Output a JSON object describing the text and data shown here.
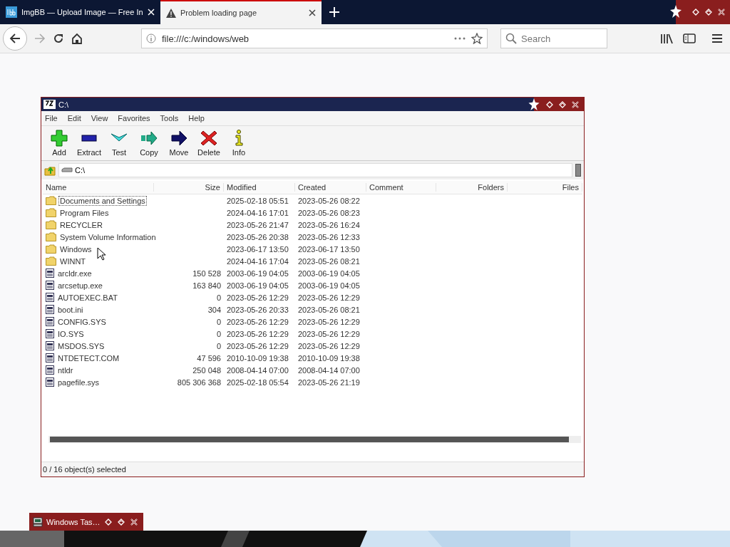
{
  "browser": {
    "tabs": [
      {
        "label": "ImgBB — Upload Image — Free In",
        "selected": false
      },
      {
        "label": "Problem loading page",
        "selected": true
      }
    ],
    "url": "file:///c:/windows/web",
    "search": {
      "placeholder": "Search"
    }
  },
  "window": {
    "title": "C:\\",
    "menu": [
      "File",
      "Edit",
      "View",
      "Favorites",
      "Tools",
      "Help"
    ],
    "toolbar": [
      {
        "label": "Add",
        "kind": "add"
      },
      {
        "label": "Extract",
        "kind": "extract"
      },
      {
        "label": "Test",
        "kind": "test"
      },
      {
        "label": "Copy",
        "kind": "copy"
      },
      {
        "label": "Move",
        "kind": "move"
      },
      {
        "label": "Delete",
        "kind": "delete"
      },
      {
        "label": "Info",
        "kind": "info"
      }
    ],
    "path": "C:\\",
    "columns": [
      "Name",
      "Size",
      "Modified",
      "Created",
      "Comment",
      "Folders",
      "Files"
    ],
    "rows": [
      {
        "kind": "folder",
        "name": "Documents and Settings",
        "size": "",
        "modified": "2025-02-18 05:51",
        "created": "2023-05-26 08:22",
        "focused": true
      },
      {
        "kind": "folder",
        "name": "Program Files",
        "size": "",
        "modified": "2024-04-16 17:01",
        "created": "2023-05-26 08:23",
        "focused": false
      },
      {
        "kind": "folder",
        "name": "RECYCLER",
        "size": "",
        "modified": "2023-05-26 21:47",
        "created": "2023-05-26 16:24",
        "focused": false
      },
      {
        "kind": "folder",
        "name": "System Volume Information",
        "size": "",
        "modified": "2023-05-26 20:38",
        "created": "2023-05-26 12:33",
        "focused": false
      },
      {
        "kind": "folder",
        "name": "Windows",
        "size": "",
        "modified": "2023-06-17 13:50",
        "created": "2023-06-17 13:50",
        "focused": false
      },
      {
        "kind": "folder",
        "name": "WINNT",
        "size": "",
        "modified": "2024-04-16 17:04",
        "created": "2023-05-26 08:21",
        "focused": false
      },
      {
        "kind": "file",
        "name": "arcldr.exe",
        "size": "150 528",
        "modified": "2003-06-19 04:05",
        "created": "2003-06-19 04:05",
        "focused": false
      },
      {
        "kind": "file",
        "name": "arcsetup.exe",
        "size": "163 840",
        "modified": "2003-06-19 04:05",
        "created": "2003-06-19 04:05",
        "focused": false
      },
      {
        "kind": "file",
        "name": "AUTOEXEC.BAT",
        "size": "0",
        "modified": "2023-05-26 12:29",
        "created": "2023-05-26 12:29",
        "focused": false
      },
      {
        "kind": "file",
        "name": "boot.ini",
        "size": "304",
        "modified": "2023-05-26 20:33",
        "created": "2023-05-26 08:21",
        "focused": false
      },
      {
        "kind": "file",
        "name": "CONFIG.SYS",
        "size": "0",
        "modified": "2023-05-26 12:29",
        "created": "2023-05-26 12:29",
        "focused": false
      },
      {
        "kind": "file",
        "name": "IO.SYS",
        "size": "0",
        "modified": "2023-05-26 12:29",
        "created": "2023-05-26 12:29",
        "focused": false
      },
      {
        "kind": "file",
        "name": "MSDOS.SYS",
        "size": "0",
        "modified": "2023-05-26 12:29",
        "created": "2023-05-26 12:29",
        "focused": false
      },
      {
        "kind": "file",
        "name": "NTDETECT.COM",
        "size": "47 596",
        "modified": "2010-10-09 19:38",
        "created": "2010-10-09 19:38",
        "focused": false
      },
      {
        "kind": "file",
        "name": "ntldr",
        "size": "250 048",
        "modified": "2008-04-14 07:00",
        "created": "2008-04-14 07:00",
        "focused": false
      },
      {
        "kind": "file",
        "name": "pagefile.sys",
        "size": "805 306 368",
        "modified": "2025-02-18 05:54",
        "created": "2023-05-26 21:19",
        "focused": false
      }
    ],
    "status": "0 / 16 object(s) selected"
  },
  "taskbar_window": {
    "title": "Windows Tas…"
  }
}
